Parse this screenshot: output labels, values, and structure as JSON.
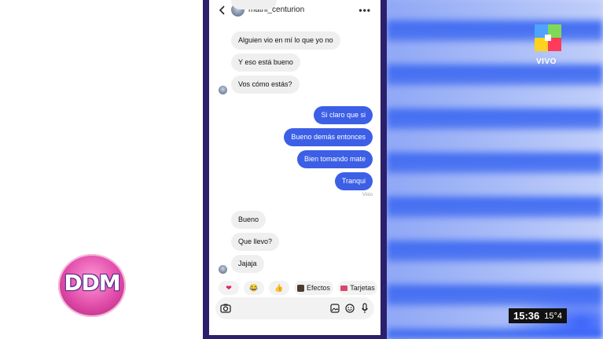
{
  "header": {
    "username": "mathi_centurion"
  },
  "messages_in_top": [
    "Alguien vio en mí lo que yo no",
    "Y eso está bueno",
    "Vos cómo estás?"
  ],
  "messages_out": [
    "Si claro que si",
    "Bueno demás entonces",
    "Bien tomando mate",
    "Tranqui"
  ],
  "seen_label": "Visto",
  "messages_in_bottom": [
    "Bueno",
    "Que llevo?",
    "Jajaja"
  ],
  "reactions": {
    "heart": "❤",
    "laugh": "😂",
    "thumb": "👍",
    "effects_label": "Efectos",
    "cards_label": "Tarjetas"
  },
  "overlay": {
    "show_logo": "DDM",
    "live_label": "VIVO",
    "time": "15:36",
    "temperature": "15°4"
  },
  "colors": {
    "outgoing_bubble": "#3c5fe6",
    "incoming_bubble": "#efefef",
    "phone_border": "#2c1f6b"
  }
}
